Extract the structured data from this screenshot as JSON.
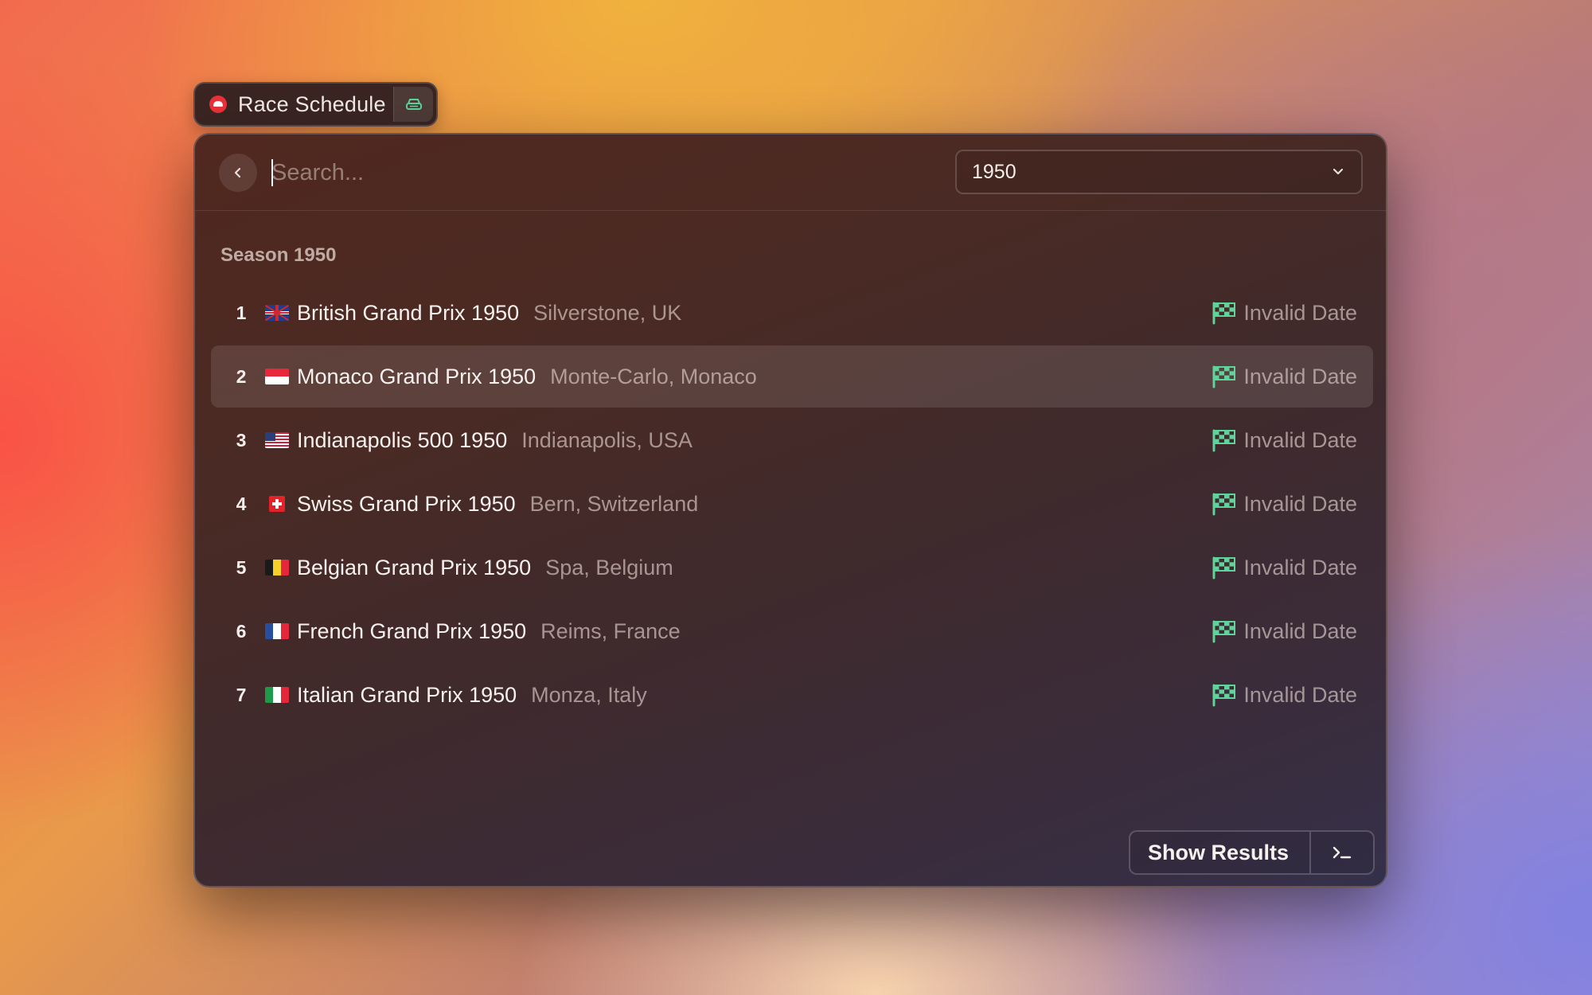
{
  "extension": {
    "title": "Race Schedule",
    "logo_icon": "race-helmet-icon",
    "action_icon": "car-icon"
  },
  "search": {
    "placeholder": "Search...",
    "value": ""
  },
  "season_dropdown": {
    "selected": "1950",
    "icon": "chevron-down-icon"
  },
  "section": {
    "title": "Season 1950"
  },
  "races": [
    {
      "index": "1",
      "flag": "uk",
      "title": "British Grand Prix 1950",
      "subtitle": "Silverstone, UK",
      "date": "Invalid Date",
      "selected": false
    },
    {
      "index": "2",
      "flag": "monaco",
      "title": "Monaco Grand Prix 1950",
      "subtitle": "Monte-Carlo, Monaco",
      "date": "Invalid Date",
      "selected": true
    },
    {
      "index": "3",
      "flag": "usa",
      "title": "Indianapolis 500 1950",
      "subtitle": "Indianapolis, USA",
      "date": "Invalid Date",
      "selected": false
    },
    {
      "index": "4",
      "flag": "switzerland",
      "title": "Swiss Grand Prix 1950",
      "subtitle": "Bern, Switzerland",
      "date": "Invalid Date",
      "selected": false
    },
    {
      "index": "5",
      "flag": "belgium",
      "title": "Belgian Grand Prix 1950",
      "subtitle": "Spa, Belgium",
      "date": "Invalid Date",
      "selected": false
    },
    {
      "index": "6",
      "flag": "france",
      "title": "French Grand Prix 1950",
      "subtitle": "Reims, France",
      "date": "Invalid Date",
      "selected": false
    },
    {
      "index": "7",
      "flag": "italy",
      "title": "Italian Grand Prix 1950",
      "subtitle": "Monza, Italy",
      "date": "Invalid Date",
      "selected": false
    }
  ],
  "footer": {
    "action_label": "Show Results",
    "action_icon": "terminal-icon"
  },
  "colors": {
    "checkered_flag": "#5fd39a",
    "window_background": "#4a2a24"
  }
}
